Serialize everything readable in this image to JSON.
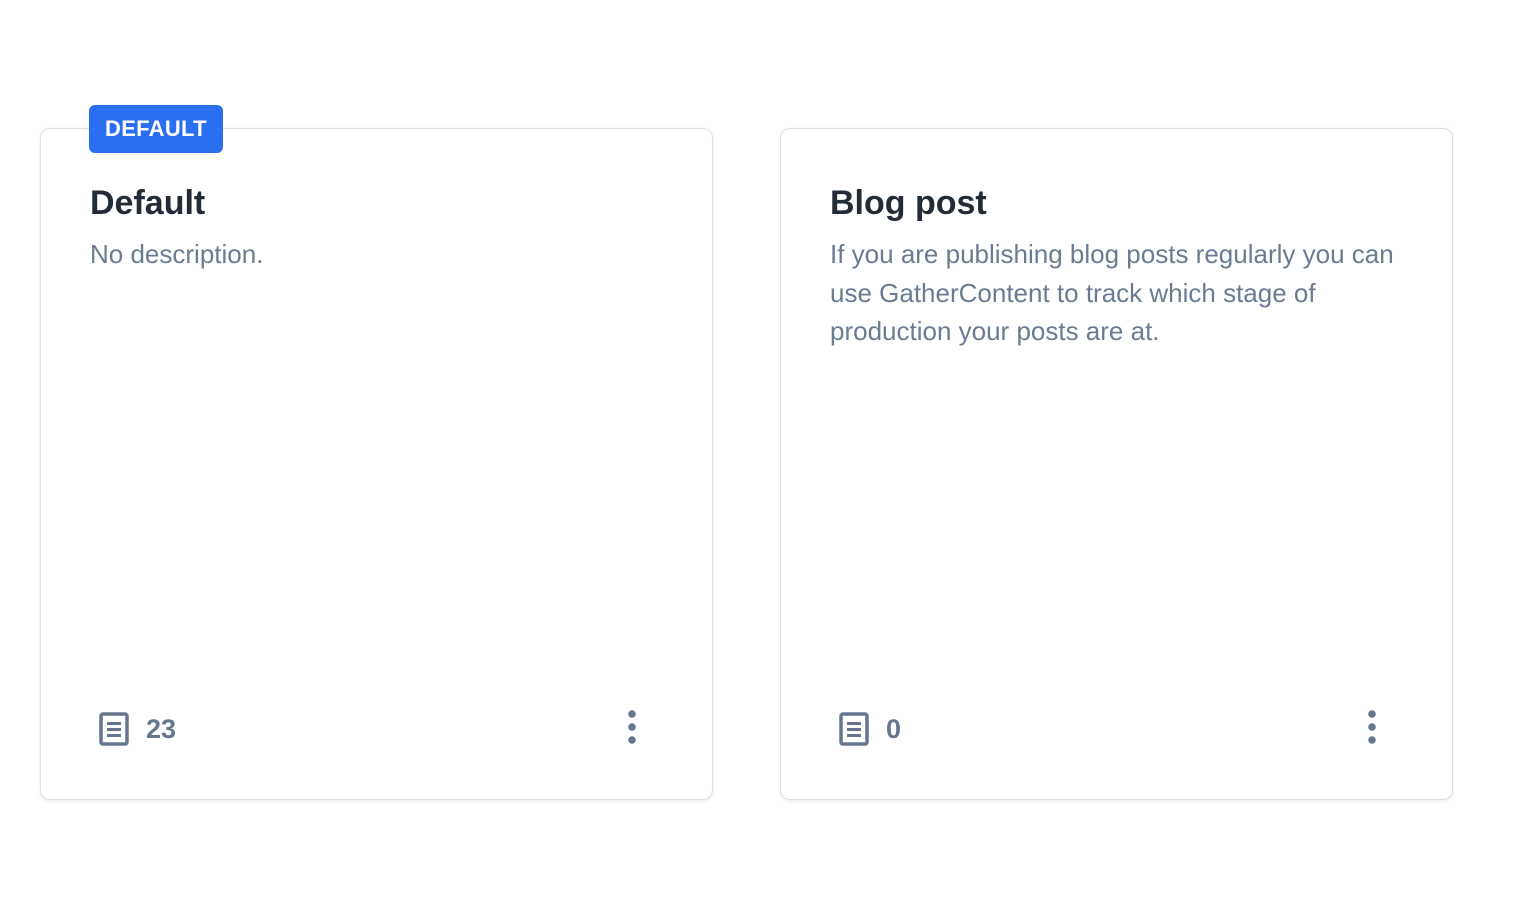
{
  "colors": {
    "accent": "#2a6ff0",
    "title": "#222b36",
    "muted": "#6a7b93",
    "border": "#dde1e6"
  },
  "cards": [
    {
      "badge": "DEFAULT",
      "title": "Default",
      "description": "No description.",
      "item_count": "23",
      "count_icon": "document-icon",
      "menu_icon": "more-vertical-icon"
    },
    {
      "title": "Blog post",
      "description": "If you are publishing blog posts regularly you can use GatherContent to track which stage of production your posts are at.",
      "item_count": "0",
      "count_icon": "document-icon",
      "menu_icon": "more-vertical-icon"
    }
  ]
}
